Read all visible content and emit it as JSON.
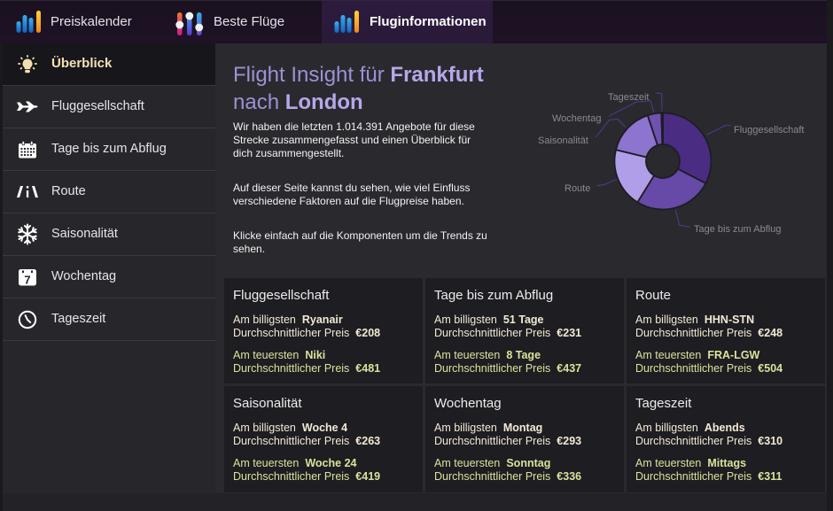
{
  "nav": {
    "tabs": [
      {
        "label": "Preiskalender",
        "icon": "bar-chart-icon",
        "active": false
      },
      {
        "label": "Beste Flüge",
        "icon": "sliders-icon",
        "active": false
      },
      {
        "label": "Fluginformationen",
        "icon": "bar-chart-icon",
        "active": true
      }
    ]
  },
  "sidebar": {
    "items": [
      {
        "label": "Überblick",
        "icon": "lightbulb-icon",
        "active": true
      },
      {
        "label": "Fluggesellschaft",
        "icon": "airplane-icon",
        "active": false
      },
      {
        "label": "Tage bis zum Abflug",
        "icon": "calendar-icon",
        "active": false
      },
      {
        "label": "Route",
        "icon": "road-icon",
        "active": false
      },
      {
        "label": "Saisonalität",
        "icon": "snowflake-icon",
        "active": false
      },
      {
        "label": "Wochentag",
        "icon": "calendar-day-icon",
        "icon_text": "7",
        "active": false
      },
      {
        "label": "Tageszeit",
        "icon": "clock-icon",
        "active": false
      }
    ]
  },
  "header": {
    "title_prefix": "Flight Insight für",
    "origin": "Frankfurt",
    "connector": "nach",
    "destination": "London"
  },
  "intro": {
    "paragraphs": [
      [
        "Wir haben die letzten 1.014.391 Angebote für diese",
        "Strecke zusammengefasst und einen Überblick für",
        "dich zusammengestellt."
      ],
      [
        "Auf dieser Seite kannst du sehen, wie viel Einfluss",
        "verschiedene Faktoren auf die Flugpreise haben."
      ],
      [
        "Klicke einfach auf die Komponenten um die Trends zu",
        "sehen."
      ]
    ]
  },
  "labels": {
    "cheapest": "Am billigsten",
    "most_expensive": "Am teuersten",
    "avg_price": "Durchschnittlicher Preis"
  },
  "cards": [
    {
      "title": "Fluggesellschaft",
      "cheapest": {
        "value": "Ryanair",
        "avg_price": "€208"
      },
      "most_expensive": {
        "value": "Niki",
        "avg_price": "€481"
      }
    },
    {
      "title": "Tage bis zum Abflug",
      "cheapest": {
        "value": "51 Tage",
        "avg_price": "€231"
      },
      "most_expensive": {
        "value": "8 Tage",
        "avg_price": "€437"
      }
    },
    {
      "title": "Route",
      "cheapest": {
        "value": "HHN-STN",
        "avg_price": "€248"
      },
      "most_expensive": {
        "value": "FRA-LGW",
        "avg_price": "€504"
      }
    },
    {
      "title": "Saisonalität",
      "cheapest": {
        "value": "Woche 4",
        "avg_price": "€263"
      },
      "most_expensive": {
        "value": "Woche 24",
        "avg_price": "€419"
      }
    },
    {
      "title": "Wochentag",
      "cheapest": {
        "value": "Montag",
        "avg_price": "€293"
      },
      "most_expensive": {
        "value": "Sonntag",
        "avg_price": "€336"
      }
    },
    {
      "title": "Tageszeit",
      "cheapest": {
        "value": "Abends",
        "avg_price": "€310"
      },
      "most_expensive": {
        "value": "Mittags",
        "avg_price": "€311"
      }
    }
  ],
  "colors": {
    "title_accent": "#b7a7ea",
    "title_soft": "#9e91d3",
    "cheapest_text": "#f1ead3",
    "most_expensive_text": "#dce29b",
    "sidebar_active_text": "#f4e2b4"
  },
  "chart_data": {
    "type": "pie",
    "variant": "donut",
    "title": "",
    "categories": [
      "Fluggesellschaft",
      "Tage bis zum Abflug",
      "Route",
      "Saisonalität",
      "Wochentag",
      "Tageszeit"
    ],
    "values": [
      32.6,
      26.2,
      20.0,
      16.1,
      4.6,
      0.5
    ],
    "value_note": "estimated share of influence in percent, read from slice angles",
    "colors": [
      "#4a2c82",
      "#6749a7",
      "#b19ee8",
      "#8d74cf",
      "#6e52af",
      "#3d2a70"
    ],
    "start": "top, clockwise",
    "legend": "none",
    "data_labels": "outside with connector lines"
  }
}
